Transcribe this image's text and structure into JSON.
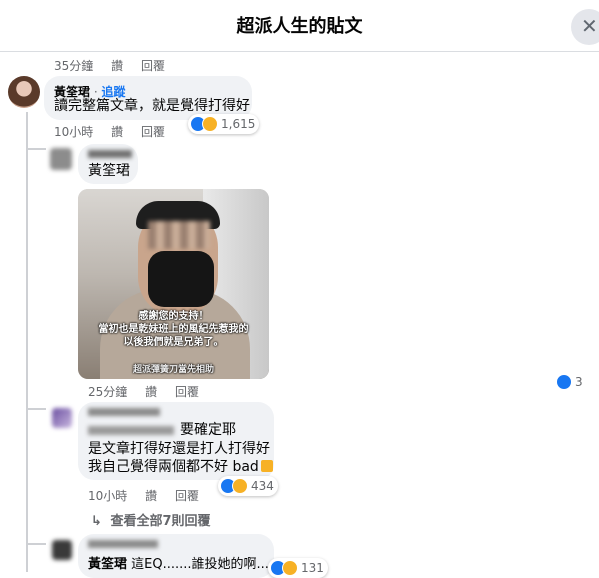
{
  "header": {
    "title": "超派人生的貼文",
    "close_glyph": "✕"
  },
  "top_meta": {
    "time": "35分鐘",
    "like": "讚",
    "reply": "回覆"
  },
  "comment1": {
    "author": "黃筌珺",
    "dot": " · ",
    "follow": "追蹤",
    "text": "讀完整篇文章，就是覺得打得好",
    "time": "10小時",
    "like": "讚",
    "reply": "回覆",
    "reactions": [
      "like-icon",
      "haha-icon"
    ],
    "reaction_count": "1,615"
  },
  "reply1": {
    "author": "",
    "text": "黃筌珺",
    "image_caption_lines": [
      "感謝您的支持！",
      "當初也是乾妹班上的風紀先惹我的",
      "以後我們就是兄弟了。"
    ],
    "image_watermark": "超派彈簧刀當先相助",
    "time": "25分鐘",
    "like": "讚",
    "reply": "回覆",
    "side_reaction_count": "3"
  },
  "reply2": {
    "text_line1": "要確定耶",
    "text_line2": "是文章打得好還是打人打得好",
    "text_line3": "我自己覺得兩個都不好 bad",
    "emoji": "thumbs-down-icon",
    "time": "10小時",
    "like": "讚",
    "reply": "回覆",
    "reaction_count": "434"
  },
  "view_more": {
    "arrow": "↳",
    "label": "查看全部7則回覆"
  },
  "reply3": {
    "mention": "黃筌珺",
    "text": " 這EQ.......誰投她的啊....",
    "reaction_count": "131"
  },
  "colors": {
    "like_blue": "#1877f2",
    "haha_yellow": "#f7b125",
    "bubble_bg": "#f0f2f5",
    "meta_gray": "#65676b"
  }
}
